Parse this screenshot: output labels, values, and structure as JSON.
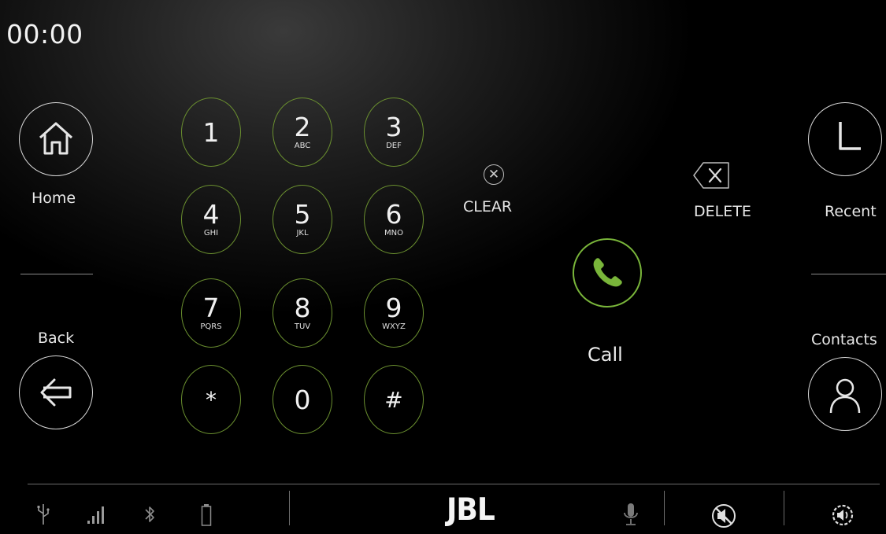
{
  "status": {
    "time": "00:00"
  },
  "nav": {
    "home_label": "Home",
    "back_label": "Back",
    "recent_label": "Recent",
    "contacts_label": "Contacts"
  },
  "keypad": [
    {
      "num": "1",
      "letters": ""
    },
    {
      "num": "2",
      "letters": "ABC"
    },
    {
      "num": "3",
      "letters": "DEF"
    },
    {
      "num": "4",
      "letters": "GHI"
    },
    {
      "num": "5",
      "letters": "JKL"
    },
    {
      "num": "6",
      "letters": "MNO"
    },
    {
      "num": "7",
      "letters": "PQRS"
    },
    {
      "num": "8",
      "letters": "TUV"
    },
    {
      "num": "9",
      "letters": "WXYZ"
    },
    {
      "num": "*",
      "letters": ""
    },
    {
      "num": "0",
      "letters": ""
    },
    {
      "num": "#",
      "letters": ""
    }
  ],
  "actions": {
    "clear_label": "CLEAR",
    "delete_label": "DELETE",
    "call_label": "Call"
  },
  "bottom_bar": {
    "brand": "JBL",
    "icons": [
      "usb-icon",
      "signal-icon",
      "bluetooth-icon",
      "battery-icon",
      "microphone-icon",
      "mute-icon",
      "volume-icon"
    ]
  },
  "colors": {
    "key_border": "#6a8f2f",
    "call_green": "#79b53a",
    "background": "#000000"
  }
}
